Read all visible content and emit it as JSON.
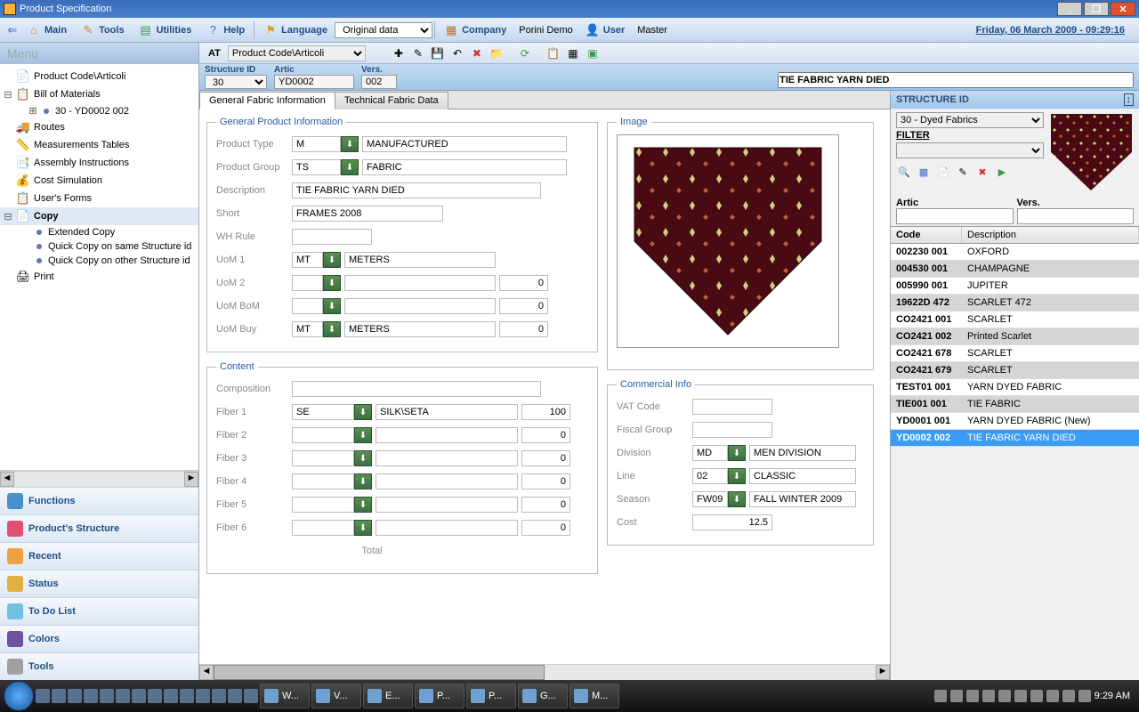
{
  "window": {
    "title": "Product Specification"
  },
  "menubar": {
    "main": "Main",
    "tools": "Tools",
    "utilities": "Utilities",
    "help": "Help",
    "language": "Language",
    "language_value": "Original data",
    "company": "Company",
    "company_value": "Porini Demo",
    "user": "User",
    "user_value": "Master",
    "datetime": "Friday, 06 March 2009 - 09:29:16"
  },
  "sidebar": {
    "header": "Menu",
    "tree": {
      "product_code": "Product Code\\Articoli",
      "bom": "Bill of Materials",
      "bom_item": "30 - YD0002 002",
      "routes": "Routes",
      "measurements": "Measurements Tables",
      "assembly": "Assembly Instructions",
      "cost_sim": "Cost Simulation",
      "users_forms": "User's Forms",
      "copy": "Copy",
      "extended_copy": "Extended Copy",
      "quick_same": "Quick Copy on same Structure id",
      "quick_other": "Quick Copy on other Structure id",
      "print": "Print"
    },
    "buttons": {
      "functions": "Functions",
      "structure": "Product's Structure",
      "recent": "Recent",
      "status": "Status",
      "todo": "To Do List",
      "colors": "Colors",
      "tools": "Tools"
    }
  },
  "atbar": {
    "label": "AT",
    "combo": "Product Code\\Articoli"
  },
  "struct": {
    "id_label": "Structure ID",
    "id": "30",
    "artic_label": "Artic",
    "artic": "YD0002",
    "vers_label": "Vers.",
    "vers": "002",
    "desc": "TIE FABRIC YARN DIED"
  },
  "tabs": {
    "general": "General Fabric Information",
    "technical": "Technical Fabric Data"
  },
  "gpi": {
    "legend": "General Product Information",
    "product_type_label": "Product Type",
    "ptype_code": "M",
    "ptype_desc": "MANUFACTURED",
    "product_group_label": "Product Group",
    "pgroup_code": "TS",
    "pgroup_desc": "FABRIC",
    "description_label": "Description",
    "description": "TIE FABRIC YARN DIED",
    "short_label": "Short",
    "short": "FRAMES 2008",
    "wh_rule_label": "WH Rule",
    "uom1_label": "UoM 1",
    "uom1_code": "MT",
    "uom1_desc": "METERS",
    "uom2_label": "UoM 2",
    "uom2_val": "0",
    "uombom_label": "UoM BoM",
    "uombom_val": "0",
    "uombuy_label": "UoM Buy",
    "uombuy_code": "MT",
    "uombuy_desc": "METERS",
    "uombuy_val": "0"
  },
  "image_legend": "Image",
  "content": {
    "legend": "Content",
    "composition_label": "Composition",
    "f1": "Fiber 1",
    "f1_code": "SE",
    "f1_desc": "SILK\\SETA",
    "f1_val": "100",
    "f2": "Fiber 2",
    "f2_val": "0",
    "f3": "Fiber 3",
    "f3_val": "0",
    "f4": "Fiber 4",
    "f4_val": "0",
    "f5": "Fiber 5",
    "f5_val": "0",
    "f6": "Fiber 6",
    "f6_val": "0",
    "total": "Total"
  },
  "commercial": {
    "legend": "Commercial Info",
    "vat_label": "VAT Code",
    "fiscal_label": "Fiscal Group",
    "division_label": "Division",
    "division_code": "MD",
    "division_desc": "MEN DIVISION",
    "line_label": "Line",
    "line_code": "02",
    "line_desc": "CLASSIC",
    "season_label": "Season",
    "season_code": "FW09",
    "season_desc": "FALL WINTER 2009",
    "cost_label": "Cost",
    "cost": "12.5"
  },
  "rightpanel": {
    "header": "STRUCTURE ID",
    "struct_combo": "30 - Dyed Fabrics",
    "filter_label": "FILTER",
    "artic_label": "Artic",
    "vers_label": "Vers.",
    "col_code": "Code",
    "col_desc": "Description",
    "rows": [
      {
        "code": "002230 001",
        "desc": "OXFORD"
      },
      {
        "code": "004530 001",
        "desc": "CHAMPAGNE"
      },
      {
        "code": "005990 001",
        "desc": "JUPITER"
      },
      {
        "code": "19622D 472",
        "desc": "SCARLET 472"
      },
      {
        "code": "CO2421 001",
        "desc": "SCARLET"
      },
      {
        "code": "CO2421 002",
        "desc": "Printed Scarlet"
      },
      {
        "code": "CO2421 678",
        "desc": "SCARLET"
      },
      {
        "code": "CO2421 679",
        "desc": "SCARLET"
      },
      {
        "code": "TEST01 001",
        "desc": "YARN DYED FABRIC"
      },
      {
        "code": "TIE001 001",
        "desc": "TIE FABRIC"
      },
      {
        "code": "YD0001 001",
        "desc": "YARN DYED FABRIC (New)"
      },
      {
        "code": "YD0002 002",
        "desc": "TIE FABRIC YARN DIED"
      }
    ]
  },
  "taskbar": {
    "items": [
      "W...",
      "V...",
      "E...",
      "P...",
      "P...",
      "G...",
      "M..."
    ],
    "clock": "9:29 AM"
  }
}
